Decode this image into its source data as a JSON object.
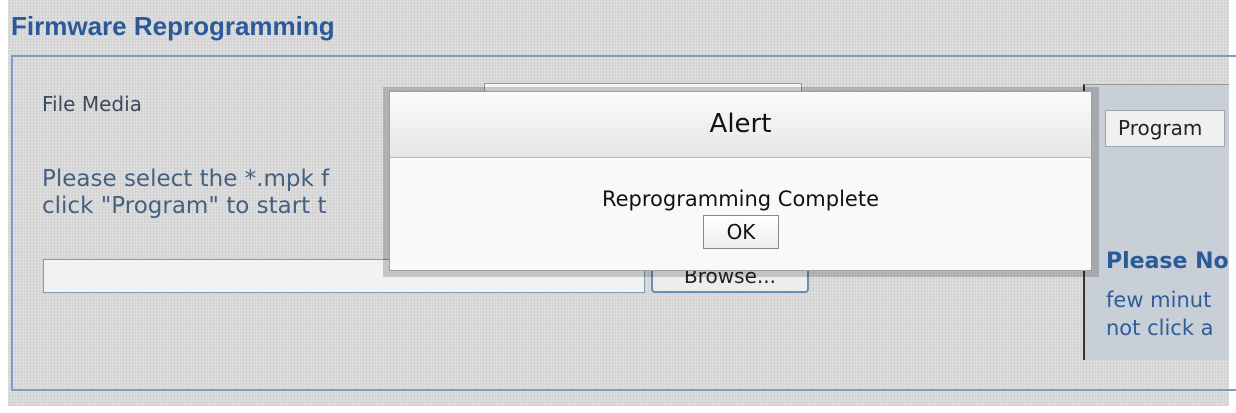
{
  "page": {
    "section_title": "Firmware Reprogramming"
  },
  "form": {
    "file_media_label": "File Media",
    "instructions": "Please select the *.mpk f\nclick \"Program\" to start t",
    "file_input_value": "",
    "browse_label": "Browse..."
  },
  "side_panel": {
    "program_label": "Program",
    "note_title": "Please No",
    "note_text": "few minut\nnot click a"
  },
  "dialog": {
    "title": "Alert",
    "message": "Reprogramming Complete",
    "ok_label": "OK"
  },
  "colors": {
    "title_blue": "#2a5a9a",
    "panel_border": "#7a9cc6",
    "background": "#d9d9d9"
  }
}
